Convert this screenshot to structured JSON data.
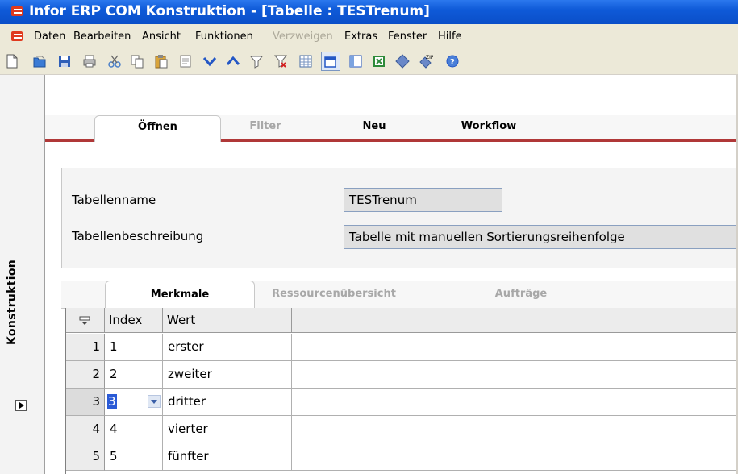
{
  "window": {
    "title": "Infor ERP COM Konstruktion - [Tabelle : TESTrenum]",
    "logo": "infor-logo-icon"
  },
  "menu": {
    "items": [
      {
        "label": "Daten",
        "enabled": true
      },
      {
        "label": "Bearbeiten",
        "enabled": true
      },
      {
        "label": "Ansicht",
        "enabled": true
      },
      {
        "label": "Funktionen",
        "enabled": true
      },
      {
        "label": "Verzweigen",
        "enabled": false
      },
      {
        "label": "Extras",
        "enabled": true
      },
      {
        "label": "Fenster",
        "enabled": true
      },
      {
        "label": "Hilfe",
        "enabled": true
      }
    ]
  },
  "toolbar": {
    "icons": [
      "new-icon",
      "open-icon",
      "save-icon",
      "print-icon",
      "cut-icon",
      "copy-icon",
      "paste-icon",
      "page-icon",
      "arrow-down-icon",
      "arrow-up-icon",
      "filter-icon",
      "clear-filter-icon",
      "table-view-icon",
      "window-icon",
      "panel-icon",
      "excel-icon",
      "diamond-icon",
      "zip-icon",
      "help-icon"
    ]
  },
  "sidebar": {
    "label": "Konstruktion"
  },
  "tabs": {
    "items": [
      "Öffnen",
      "Filter",
      "Neu",
      "Workflow"
    ],
    "selected": "Öffnen"
  },
  "form": {
    "name_label": "Tabellenname",
    "name_value": "TESTrenum",
    "desc_label": "Tabellenbeschreibung",
    "desc_value": "Tabelle mit manuellen Sortierungsreihenfolge"
  },
  "subtabs": {
    "items": [
      "Merkmale",
      "Ressourcenübersicht",
      "Aufträge"
    ],
    "selected": "Merkmale"
  },
  "grid": {
    "columns": [
      "Index",
      "Wert"
    ],
    "rows": [
      {
        "num": "1",
        "index": "1",
        "wert": "erster"
      },
      {
        "num": "2",
        "index": "2",
        "wert": "zweiter"
      },
      {
        "num": "3",
        "index": "3",
        "wert": "dritter"
      },
      {
        "num": "4",
        "index": "4",
        "wert": "vierter"
      },
      {
        "num": "5",
        "index": "5",
        "wert": "fünfter"
      }
    ],
    "editing_row": 3
  }
}
